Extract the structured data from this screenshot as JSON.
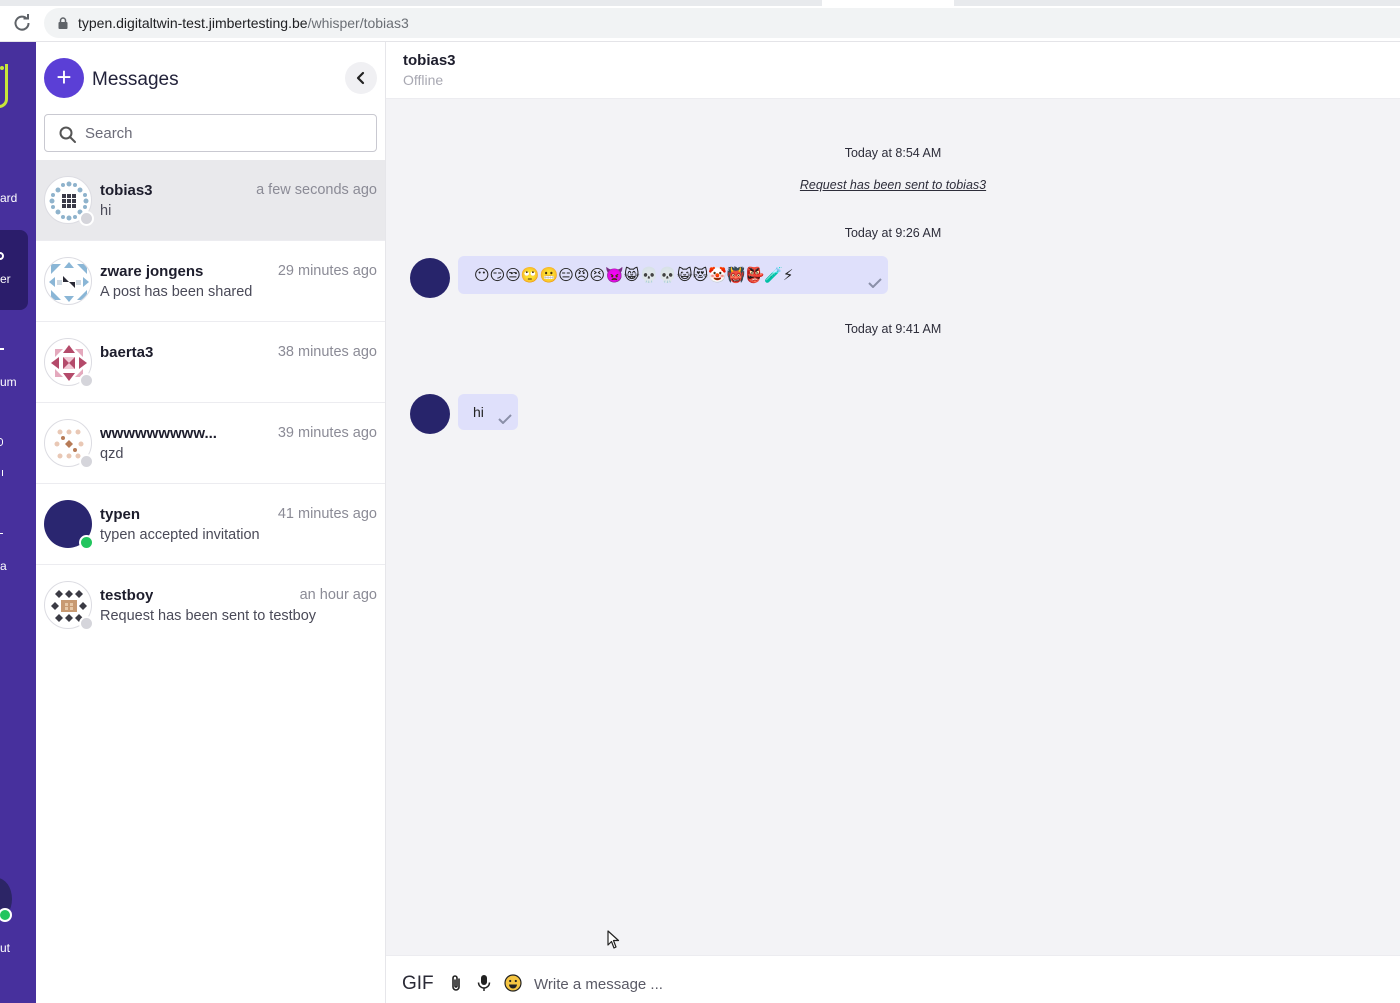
{
  "browser": {
    "url_host": "typen.digitaltwin-test.jimbertesting.be",
    "url_path": "/whisper/tobias3"
  },
  "rail": {
    "items": [
      {
        "label": "ard"
      },
      {
        "label": "er"
      },
      {
        "label": "um"
      },
      {
        "label": "a"
      },
      {
        "label": "ut"
      }
    ]
  },
  "panel": {
    "title": "Messages",
    "search_placeholder": "Search"
  },
  "conversations": [
    {
      "name": "tobias3",
      "time": "a few seconds ago",
      "preview": "hi",
      "status": "offline"
    },
    {
      "name": "zware jongens",
      "time": "29 minutes ago",
      "preview": "A post has been shared",
      "status": "none"
    },
    {
      "name": "baerta3",
      "time": "38 minutes ago",
      "preview": "",
      "status": "offline"
    },
    {
      "name": "wwwwwwwww...",
      "time": "39 minutes ago",
      "preview": "qzd",
      "status": "offline"
    },
    {
      "name": "typen",
      "time": "41 minutes ago",
      "preview": "typen accepted invitation",
      "status": "online"
    },
    {
      "name": "testboy",
      "time": "an hour ago",
      "preview": "Request has been sent to testboy",
      "status": "offline"
    }
  ],
  "chat": {
    "name": "tobias3",
    "status": "Offline",
    "messages": {
      "ts1": "Today at 8:54 AM",
      "system": "Request has been sent to tobias3",
      "ts2": "Today at 9:26 AM",
      "emoji": "😶😏😒🙄😬😑😠😣👿😸💀💀😺😻🤡👹👺🧪⚡",
      "ts3": "Today at 9:41 AM",
      "hi": "hi"
    }
  },
  "composer": {
    "gif_label": "GIF",
    "placeholder": "Write a message ..."
  },
  "colors": {
    "rail": "#47309d",
    "accent": "#5b3fd6",
    "bubble": "#dfe0fb",
    "avatar_dark": "#27246b",
    "online": "#22c55e"
  }
}
